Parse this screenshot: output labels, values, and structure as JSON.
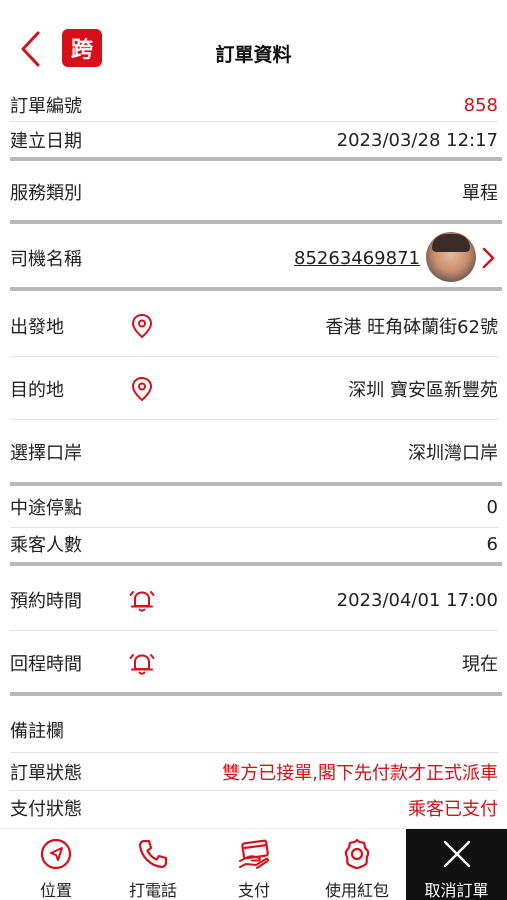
{
  "header": {
    "title": "訂單資料",
    "logo_text": "跨"
  },
  "order": {
    "order_no_label": "訂單編號",
    "order_no": "858",
    "created_label": "建立日期",
    "created": "2023/03/28 12:17",
    "service_label": "服務類別",
    "service": "單程",
    "driver_label": "司機名稱",
    "driver": "85263469871",
    "departure_label": "出發地",
    "departure": "香港 旺角砵蘭街62號",
    "destination_label": "目的地",
    "destination": "深圳 寶安區新豐苑",
    "port_label": "選擇口岸",
    "port": "深圳灣口岸",
    "stops_label": "中途停點",
    "stops": "0",
    "passengers_label": "乘客人數",
    "passengers": "6",
    "booking_time_label": "預約時間",
    "booking_time": "2023/04/01 17:00",
    "return_time_label": "回程時間",
    "return_time": "現在",
    "remarks_label": "備註欄",
    "order_status_label": "訂單狀態",
    "order_status": "雙方已接單,閣下先付款才正式派車",
    "payment_status_label": "支付狀態",
    "payment_status": "乘客已支付"
  },
  "tabs": {
    "location": "位置",
    "call": "打電話",
    "pay": "支付",
    "red_packet": "使用紅包",
    "cancel": "取消訂單"
  },
  "colors": {
    "accent": "#d5101a",
    "divider": "#b8b8b8",
    "cancel_bg": "#111111"
  },
  "icons": [
    "back-arrow-icon",
    "logo-icon",
    "map-pin-icon",
    "alarm-bell-icon",
    "chevron-right-icon",
    "navigation-icon",
    "phone-icon",
    "payment-icon",
    "gift-icon",
    "close-icon"
  ]
}
